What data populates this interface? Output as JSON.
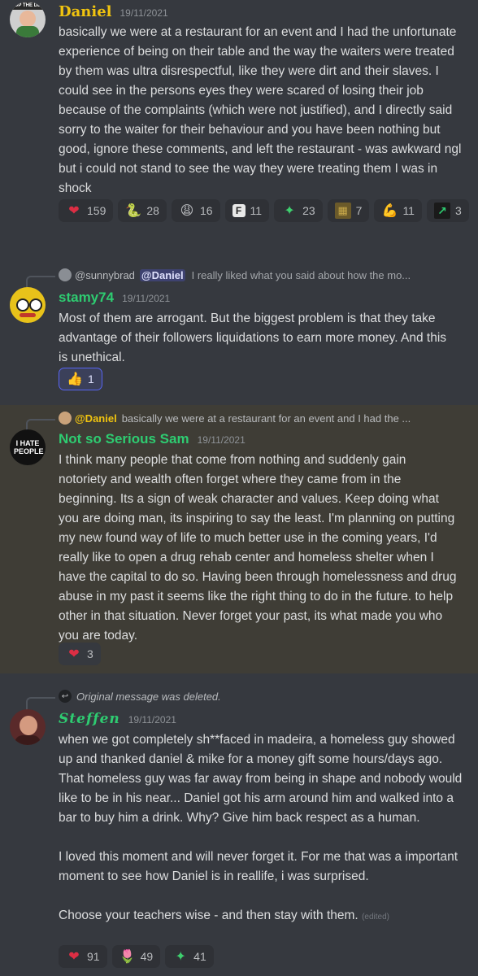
{
  "msg1": {
    "author": "Daniel",
    "author_color": "#f1c40f",
    "avatar_text": "UP THE DE",
    "timestamp": "19/11/2021",
    "text": "basically we were at a restaurant for an event and I had the unfortunate experience of being on their table and the way the waiters were treated by them was ultra disrespectful, like they were dirt and their slaves. I could see in the persons eyes they were scared of losing their job because of the complaints (which were not justified), and I directly said sorry to the waiter for their behaviour and you have been nothing but good, ignore these comments, and left the restaurant - was awkward ngl but i could not stand to see the way they were treating them I was in shock",
    "reactions": [
      {
        "emoji": "red-heart",
        "glyph": "❤",
        "count": "159"
      },
      {
        "emoji": "snake",
        "glyph": "🐍",
        "count": "28"
      },
      {
        "emoji": "weary-face",
        "glyph": "😩",
        "count": "16"
      },
      {
        "emoji": "f-letter",
        "glyph": "F",
        "count": "11"
      },
      {
        "emoji": "green-crystal",
        "glyph": "✦",
        "count": "23"
      },
      {
        "emoji": "painting",
        "glyph": "▦",
        "count": "7"
      },
      {
        "emoji": "flexed-biceps",
        "glyph": "💪",
        "count": "11"
      },
      {
        "emoji": "stonks-chart",
        "glyph": "↗",
        "count": "3"
      }
    ]
  },
  "msg2": {
    "reply_user": "@sunnybrad",
    "reply_mention": "@Daniel",
    "reply_text": "I really liked what you said about how the mo...",
    "author": "stamy74",
    "author_color": "#2ecc71",
    "timestamp": "19/11/2021",
    "text": "Most of them are arrogant. But the biggest problem is that they take advantage of their followers liquidations to earn more money. And this is unethical.",
    "reactions": [
      {
        "emoji": "thumbs-up",
        "glyph": "👍",
        "count": "1"
      }
    ]
  },
  "msg3": {
    "reply_user": "@Daniel",
    "reply_text": "basically we were at a restaurant for an event and I had the ...",
    "author": "Not so Serious Sam",
    "author_color": "#2ecc71",
    "avatar_text": "I HATE PEOPLE",
    "timestamp": "19/11/2021",
    "text": "I think many people that come from nothing and suddenly gain notoriety and wealth often forget where they came from in the beginning. Its a sign of weak character and values. Keep doing what you are doing man, its inspiring to say the least. I'm planning on putting my new found way of life to much better use in the coming years, I'd really like to open a drug rehab center and homeless shelter when I have the capital to do so. Having been through homelessness and drug abuse in my past it seems like the right thing to do in the future. to help other in that situation. Never forget your past, its what made you who you are today.",
    "reactions": [
      {
        "emoji": "red-heart",
        "glyph": "❤",
        "count": "3"
      }
    ]
  },
  "msg4": {
    "reply_text": "Original message was deleted.",
    "author": "Steffen",
    "author_color": "#2ecc71",
    "timestamp": "19/11/2021",
    "paragraphs": [
      "when we got completely sh**faced in madeira, a homeless guy showed up and thanked daniel & mike for a money gift some hours/days ago. That homeless guy was far away from being in shape and nobody would like to be in his near... Daniel got his arm around him and walked into a bar to buy him a drink. Why? Give him back respect as a human.",
      "I loved this moment and will never forget it. For me that was a important moment to see how Daniel is in reallife, i was surprised.",
      "Choose your teachers wise - and then stay with them."
    ],
    "edited_label": "(edited)",
    "reactions": [
      {
        "emoji": "red-heart",
        "glyph": "❤",
        "count": "91"
      },
      {
        "emoji": "pink-tulip",
        "glyph": "🌷",
        "count": "49"
      },
      {
        "emoji": "green-crystal",
        "glyph": "✦",
        "count": "41"
      }
    ]
  }
}
